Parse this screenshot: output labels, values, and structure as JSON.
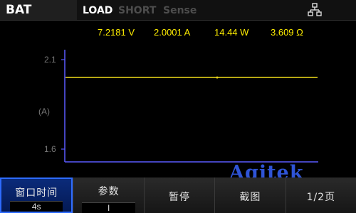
{
  "topbar": {
    "modes": {
      "bat": "BAT",
      "load": "LOAD",
      "short": "SHORT",
      "sense": "Sense"
    },
    "network_icon": "network-icon"
  },
  "readings": {
    "voltage": "7.2181 V",
    "current": "2.0001 A",
    "power": "14.44 W",
    "resistance": "3.609 Ω"
  },
  "plot": {
    "y_top_label": "2.1",
    "y_bottom_label": "1.6",
    "y_unit": "(A)",
    "trace_value_a": 2.0001,
    "ylim": [
      1.6,
      2.1
    ],
    "colors": {
      "trace": "#e6d21a",
      "axis": "#5a5aff",
      "reading": "#ffee00"
    }
  },
  "softkeys": [
    {
      "label": "窗口时间",
      "sub": "4s"
    },
    {
      "label": "参数",
      "sub": "I"
    },
    {
      "label": "暂停"
    },
    {
      "label": "截图"
    },
    {
      "label": "1/2页"
    }
  ],
  "watermark": "Agitek"
}
